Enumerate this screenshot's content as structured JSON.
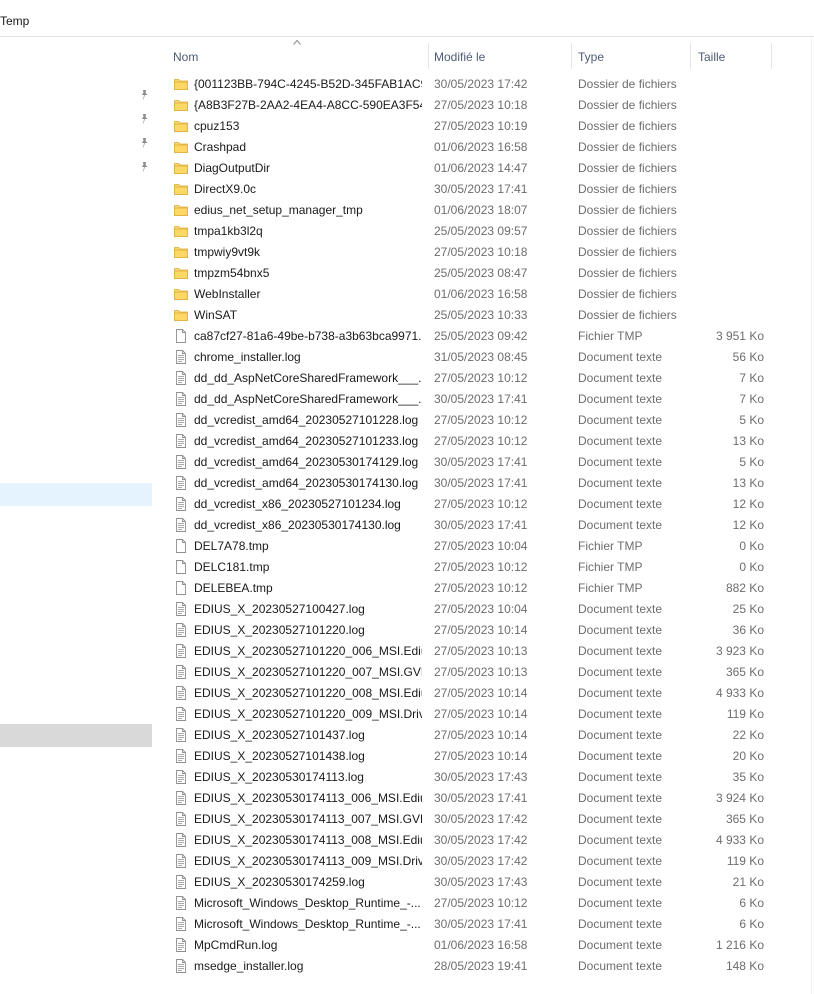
{
  "address": {
    "current_folder": "Temp"
  },
  "columns": {
    "name": "Nom",
    "modified": "Modifié le",
    "type": "Type",
    "size": "Taille"
  },
  "nav": {
    "pins": [
      "pin-icon",
      "pin-icon",
      "pin-icon",
      "pin-icon"
    ]
  },
  "files": [
    {
      "name": "{001123BB-794C-4245-B52D-345FAB1AC9...",
      "date": "30/05/2023 17:42",
      "type": "Dossier de fichiers",
      "size": "",
      "kind": "folder"
    },
    {
      "name": "{A8B3F27B-2AA2-4EA4-A8CC-590EA3F54...",
      "date": "27/05/2023 10:18",
      "type": "Dossier de fichiers",
      "size": "",
      "kind": "folder"
    },
    {
      "name": "cpuz153",
      "date": "27/05/2023 10:19",
      "type": "Dossier de fichiers",
      "size": "",
      "kind": "folder"
    },
    {
      "name": "Crashpad",
      "date": "01/06/2023 16:58",
      "type": "Dossier de fichiers",
      "size": "",
      "kind": "folder"
    },
    {
      "name": "DiagOutputDir",
      "date": "01/06/2023 14:47",
      "type": "Dossier de fichiers",
      "size": "",
      "kind": "folder"
    },
    {
      "name": "DirectX9.0c",
      "date": "30/05/2023 17:41",
      "type": "Dossier de fichiers",
      "size": "",
      "kind": "folder"
    },
    {
      "name": "edius_net_setup_manager_tmp",
      "date": "01/06/2023 18:07",
      "type": "Dossier de fichiers",
      "size": "",
      "kind": "folder"
    },
    {
      "name": "tmpa1kb3l2q",
      "date": "25/05/2023 09:57",
      "type": "Dossier de fichiers",
      "size": "",
      "kind": "folder"
    },
    {
      "name": "tmpwiy9vt9k",
      "date": "27/05/2023 10:18",
      "type": "Dossier de fichiers",
      "size": "",
      "kind": "folder"
    },
    {
      "name": "tmpzm54bnx5",
      "date": "25/05/2023 08:47",
      "type": "Dossier de fichiers",
      "size": "",
      "kind": "folder"
    },
    {
      "name": "WebInstaller",
      "date": "01/06/2023 16:58",
      "type": "Dossier de fichiers",
      "size": "",
      "kind": "folder"
    },
    {
      "name": "WinSAT",
      "date": "25/05/2023 10:33",
      "type": "Dossier de fichiers",
      "size": "",
      "kind": "folder"
    },
    {
      "name": "ca87cf27-81a6-49be-b738-a3b63bca9971....",
      "date": "25/05/2023 09:42",
      "type": "Fichier TMP",
      "size": "3 951 Ko",
      "kind": "tmp"
    },
    {
      "name": "chrome_installer.log",
      "date": "31/05/2023 08:45",
      "type": "Document texte",
      "size": "56 Ko",
      "kind": "text"
    },
    {
      "name": "dd_dd_AspNetCoreSharedFramework___...",
      "date": "27/05/2023 10:12",
      "type": "Document texte",
      "size": "7 Ko",
      "kind": "text"
    },
    {
      "name": "dd_dd_AspNetCoreSharedFramework___...",
      "date": "30/05/2023 17:41",
      "type": "Document texte",
      "size": "7 Ko",
      "kind": "text"
    },
    {
      "name": "dd_vcredist_amd64_20230527101228.log",
      "date": "27/05/2023 10:12",
      "type": "Document texte",
      "size": "5 Ko",
      "kind": "text"
    },
    {
      "name": "dd_vcredist_amd64_20230527101233.log",
      "date": "27/05/2023 10:12",
      "type": "Document texte",
      "size": "13 Ko",
      "kind": "text"
    },
    {
      "name": "dd_vcredist_amd64_20230530174129.log",
      "date": "30/05/2023 17:41",
      "type": "Document texte",
      "size": "5 Ko",
      "kind": "text"
    },
    {
      "name": "dd_vcredist_amd64_20230530174130.log",
      "date": "30/05/2023 17:41",
      "type": "Document texte",
      "size": "13 Ko",
      "kind": "text"
    },
    {
      "name": "dd_vcredist_x86_20230527101234.log",
      "date": "27/05/2023 10:12",
      "type": "Document texte",
      "size": "12 Ko",
      "kind": "text"
    },
    {
      "name": "dd_vcredist_x86_20230530174130.log",
      "date": "30/05/2023 17:41",
      "type": "Document texte",
      "size": "12 Ko",
      "kind": "text"
    },
    {
      "name": "DEL7A78.tmp",
      "date": "27/05/2023 10:04",
      "type": "Fichier TMP",
      "size": "0 Ko",
      "kind": "tmp"
    },
    {
      "name": "DELC181.tmp",
      "date": "27/05/2023 10:12",
      "type": "Fichier TMP",
      "size": "0 Ko",
      "kind": "tmp"
    },
    {
      "name": "DELEBEA.tmp",
      "date": "27/05/2023 10:12",
      "type": "Fichier TMP",
      "size": "882 Ko",
      "kind": "tmp"
    },
    {
      "name": "EDIUS_X_20230527100427.log",
      "date": "27/05/2023 10:04",
      "type": "Document texte",
      "size": "25 Ko",
      "kind": "text"
    },
    {
      "name": "EDIUS_X_20230527101220.log",
      "date": "27/05/2023 10:14",
      "type": "Document texte",
      "size": "36 Ko",
      "kind": "text"
    },
    {
      "name": "EDIUS_X_20230527101220_006_MSI.Edius.I...",
      "date": "27/05/2023 10:13",
      "type": "Document texte",
      "size": "3 923 Ko",
      "kind": "text"
    },
    {
      "name": "EDIUS_X_20230527101220_007_MSI.GVLic...",
      "date": "27/05/2023 10:13",
      "type": "Document texte",
      "size": "365 Ko",
      "kind": "text"
    },
    {
      "name": "EDIUS_X_20230527101220_008_MSI.Edius...",
      "date": "27/05/2023 10:14",
      "type": "Document texte",
      "size": "4 933 Ko",
      "kind": "text"
    },
    {
      "name": "EDIUS_X_20230527101220_009_MSI.Driver....",
      "date": "27/05/2023 10:14",
      "type": "Document texte",
      "size": "119 Ko",
      "kind": "text"
    },
    {
      "name": "EDIUS_X_20230527101437.log",
      "date": "27/05/2023 10:14",
      "type": "Document texte",
      "size": "22 Ko",
      "kind": "text"
    },
    {
      "name": "EDIUS_X_20230527101438.log",
      "date": "27/05/2023 10:14",
      "type": "Document texte",
      "size": "20 Ko",
      "kind": "text"
    },
    {
      "name": "EDIUS_X_20230530174113.log",
      "date": "30/05/2023 17:43",
      "type": "Document texte",
      "size": "35 Ko",
      "kind": "text"
    },
    {
      "name": "EDIUS_X_20230530174113_006_MSI.Edius.I...",
      "date": "30/05/2023 17:41",
      "type": "Document texte",
      "size": "3 924 Ko",
      "kind": "text"
    },
    {
      "name": "EDIUS_X_20230530174113_007_MSI.GVLic...",
      "date": "30/05/2023 17:42",
      "type": "Document texte",
      "size": "365 Ko",
      "kind": "text"
    },
    {
      "name": "EDIUS_X_20230530174113_008_MSI.Edius...",
      "date": "30/05/2023 17:42",
      "type": "Document texte",
      "size": "4 933 Ko",
      "kind": "text"
    },
    {
      "name": "EDIUS_X_20230530174113_009_MSI.Driver....",
      "date": "30/05/2023 17:42",
      "type": "Document texte",
      "size": "119 Ko",
      "kind": "text"
    },
    {
      "name": "EDIUS_X_20230530174259.log",
      "date": "30/05/2023 17:43",
      "type": "Document texte",
      "size": "21 Ko",
      "kind": "text"
    },
    {
      "name": "Microsoft_Windows_Desktop_Runtime_-...",
      "date": "27/05/2023 10:12",
      "type": "Document texte",
      "size": "6 Ko",
      "kind": "text"
    },
    {
      "name": "Microsoft_Windows_Desktop_Runtime_-...",
      "date": "30/05/2023 17:41",
      "type": "Document texte",
      "size": "6 Ko",
      "kind": "text"
    },
    {
      "name": "MpCmdRun.log",
      "date": "01/06/2023 16:58",
      "type": "Document texte",
      "size": "1 216 Ko",
      "kind": "text"
    },
    {
      "name": "msedge_installer.log",
      "date": "28/05/2023 19:41",
      "type": "Document texte",
      "size": "148 Ko",
      "kind": "text"
    }
  ]
}
